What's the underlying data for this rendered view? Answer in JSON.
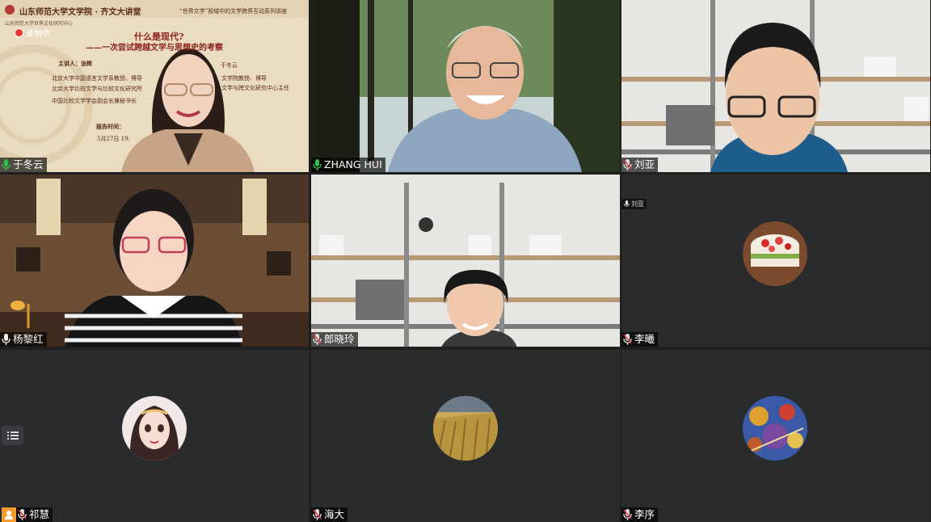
{
  "participants": [
    {
      "name": "于冬云",
      "mic": "on"
    },
    {
      "name": "ZHANG HUI",
      "mic": "on"
    },
    {
      "name": "刘亚",
      "mic": "muted"
    },
    {
      "name": "杨黎红",
      "mic": "on"
    },
    {
      "name": "郎晓玲",
      "mic": "muted"
    },
    {
      "name": "李曦",
      "mic": "muted",
      "small_label": "刘亚"
    },
    {
      "name": "祁慧",
      "mic": "muted"
    },
    {
      "name": "海大",
      "mic": "muted"
    },
    {
      "name": "李序",
      "mic": "muted"
    }
  ],
  "slide": {
    "header_left": "山东师范大学文学院 · 齐文大讲堂",
    "header_right": "“世界文学”视域中的文学跨界互动系列讲座",
    "sub_left": "山东师范大学世界文化研究中心",
    "recording": "录制中",
    "title": "什么是现代?",
    "subtitle": "——一次尝试跨越文学与思想史的考察",
    "speaker": "主讲人：张辉",
    "host": "于冬云",
    "line1": "北京大学中国语言文学系教授、博导",
    "line1b": "文学院教授、博导",
    "line2": "北京大学比较文学与比较文化研究所",
    "line2b": "文学与跨文化研究中心主任",
    "line3": "中国比较文学学会副会长兼秘书长",
    "time_label": "报告时间：",
    "time_value": "5月27日 19:"
  },
  "colors": {
    "mic_on": "#2fc14b",
    "mic_muted": "#e0e0e0",
    "mic_slash": "#e23b3b"
  }
}
